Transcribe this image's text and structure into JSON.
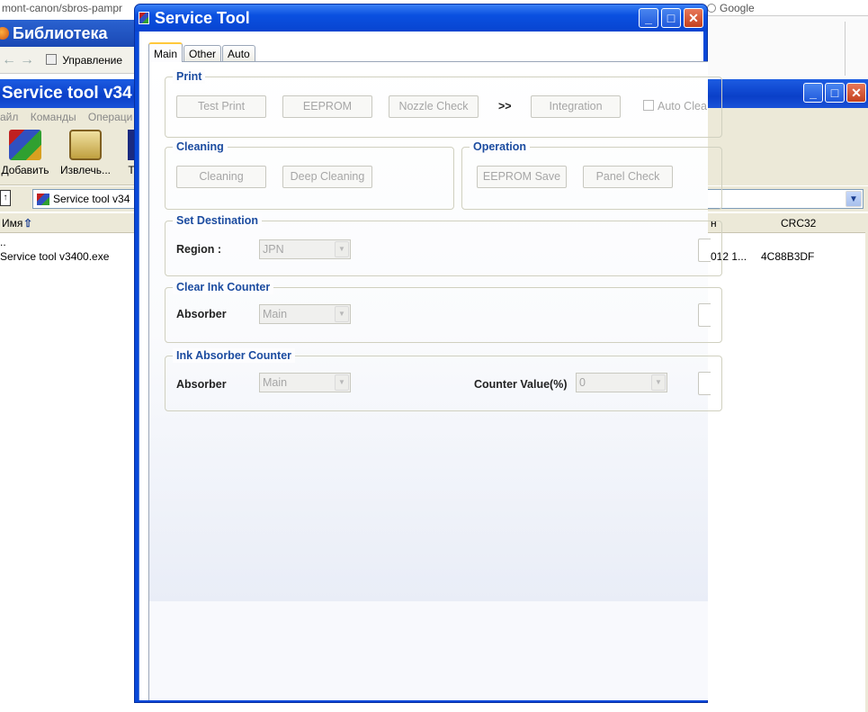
{
  "browser": {
    "url_fragment": "mont-canon/sbros-pampr",
    "search_engine": "Google",
    "library_title": "Библиотека",
    "manage_label": "Управление"
  },
  "winrar": {
    "title": "Service tool v34",
    "menu": [
      "айл",
      "Команды",
      "Операци"
    ],
    "toolbar": [
      {
        "label": "Добавить",
        "icon": "add-archive-icon"
      },
      {
        "label": "Извлечь...",
        "icon": "extract-icon"
      },
      {
        "label": "Т",
        "icon": "test-icon"
      }
    ],
    "path_value": "Service tool v34",
    "columns": {
      "name": "Имя",
      "modified": "н",
      "crc": "CRC32"
    },
    "rows": [
      {
        "name": "..",
        "modified": "",
        "crc": ""
      },
      {
        "name": "Service tool v3400.exe",
        "modified": "012 1...",
        "crc": "4C88B3DF"
      }
    ]
  },
  "service_tool": {
    "title": "Service Tool",
    "tabs": [
      "Main",
      "Other",
      "Auto"
    ],
    "active_tab": "Main",
    "print": {
      "title": "Print",
      "test_print": "Test Print",
      "eeprom": "EEPROM",
      "nozzle_check": "Nozzle Check",
      "arrow": ">>",
      "integration": "Integration",
      "auto_clean": "Auto Clea"
    },
    "cleaning": {
      "title": "Cleaning",
      "cleaning": "Cleaning",
      "deep_cleaning": "Deep Cleaning"
    },
    "operation": {
      "title": "Operation",
      "eeprom_save": "EEPROM Save",
      "panel_check": "Panel Check"
    },
    "set_destination": {
      "title": "Set Destination",
      "region_label": "Region :",
      "region_value": "JPN"
    },
    "clear_ink_counter": {
      "title": "Clear Ink Counter",
      "absorber_label": "Absorber",
      "absorber_value": "Main"
    },
    "ink_absorber_counter": {
      "title": "Ink Absorber Counter",
      "absorber_label": "Absorber",
      "absorber_value": "Main",
      "counter_label": "Counter Value(%)",
      "counter_value": "0"
    }
  }
}
